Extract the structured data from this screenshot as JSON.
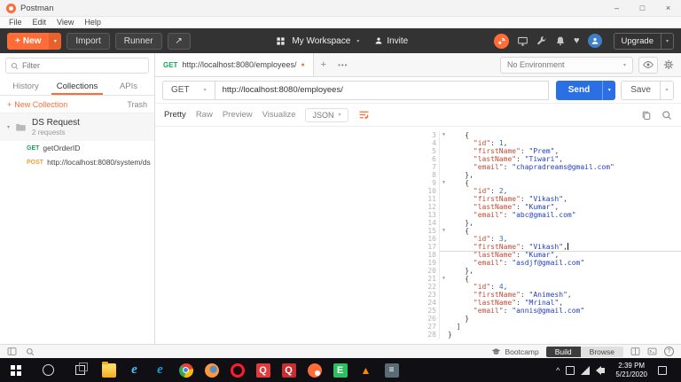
{
  "app": {
    "title": "Postman",
    "menu": [
      "File",
      "Edit",
      "View",
      "Help"
    ]
  },
  "icons": {
    "plus": "+",
    "caret": "▾",
    "dots": "•••",
    "close": "×",
    "minimize": "–",
    "maximize": "□",
    "heart": "♥",
    "open_new": "↗",
    "unsaved_dot": "●",
    "fold": "▼",
    "hidden_caret": "^",
    "question": "?"
  },
  "toolbar": {
    "new_label": "New",
    "import_label": "Import",
    "runner_label": "Runner",
    "workspace_label": "My Workspace",
    "invite_label": "Invite",
    "upgrade_label": "Upgrade"
  },
  "sidebar": {
    "filter_placeholder": "Filter",
    "tabs": [
      "History",
      "Collections",
      "APIs"
    ],
    "active_tab": "Collections",
    "new_collection_label": "New Collection",
    "trash_label": "Trash",
    "collection": {
      "name": "DS Request",
      "meta": "2 requests",
      "items": [
        {
          "method": "GET",
          "label": "getOrderID"
        },
        {
          "method": "POST",
          "label": "http://localhost:8080/system/ds"
        }
      ]
    }
  },
  "request_tab": {
    "method": "GET",
    "url": "http://localhost:8080/employees/"
  },
  "environment": {
    "selected": "No Environment"
  },
  "request_bar": {
    "method": "GET",
    "url": "http://localhost:8080/employees/",
    "send_label": "Send",
    "save_label": "Save"
  },
  "response": {
    "view_tabs": [
      "Pretty",
      "Raw",
      "Preview",
      "Visualize"
    ],
    "active_view": "Pretty",
    "language": "JSON",
    "lines": [
      {
        "n": 3,
        "lvl": 2,
        "f": true,
        "t": [
          [
            "p",
            "{"
          ]
        ]
      },
      {
        "n": 4,
        "lvl": 3,
        "t": [
          [
            "k",
            "\"id\""
          ],
          [
            "p",
            ": "
          ],
          [
            "m",
            "1"
          ],
          [
            "p",
            ","
          ]
        ]
      },
      {
        "n": 5,
        "lvl": 3,
        "t": [
          [
            "k",
            "\"firstName\""
          ],
          [
            "p",
            ": "
          ],
          [
            "s",
            "\"Prem\""
          ],
          [
            "p",
            ","
          ]
        ]
      },
      {
        "n": 6,
        "lvl": 3,
        "t": [
          [
            "k",
            "\"lastName\""
          ],
          [
            "p",
            ": "
          ],
          [
            "s",
            "\"Tiwari\""
          ],
          [
            "p",
            ","
          ]
        ]
      },
      {
        "n": 7,
        "lvl": 3,
        "t": [
          [
            "k",
            "\"email\""
          ],
          [
            "p",
            ": "
          ],
          [
            "s",
            "\"chapradreams@gmail.com\""
          ]
        ]
      },
      {
        "n": 8,
        "lvl": 2,
        "t": [
          [
            "p",
            "},"
          ]
        ]
      },
      {
        "n": 9,
        "lvl": 2,
        "f": true,
        "t": [
          [
            "p",
            "{"
          ]
        ]
      },
      {
        "n": 10,
        "lvl": 3,
        "t": [
          [
            "k",
            "\"id\""
          ],
          [
            "p",
            ": "
          ],
          [
            "m",
            "2"
          ],
          [
            "p",
            ","
          ]
        ]
      },
      {
        "n": 11,
        "lvl": 3,
        "t": [
          [
            "k",
            "\"firstName\""
          ],
          [
            "p",
            ": "
          ],
          [
            "s",
            "\"Vikash\""
          ],
          [
            "p",
            ","
          ]
        ]
      },
      {
        "n": 12,
        "lvl": 3,
        "t": [
          [
            "k",
            "\"lastName\""
          ],
          [
            "p",
            ": "
          ],
          [
            "s",
            "\"Kumar\""
          ],
          [
            "p",
            ","
          ]
        ]
      },
      {
        "n": 13,
        "lvl": 3,
        "t": [
          [
            "k",
            "\"email\""
          ],
          [
            "p",
            ": "
          ],
          [
            "s",
            "\"abc@gmail.com\""
          ]
        ]
      },
      {
        "n": 14,
        "lvl": 2,
        "t": [
          [
            "p",
            "},"
          ]
        ]
      },
      {
        "n": 15,
        "lvl": 2,
        "f": true,
        "t": [
          [
            "p",
            "{"
          ]
        ]
      },
      {
        "n": 16,
        "lvl": 3,
        "t": [
          [
            "k",
            "\"id\""
          ],
          [
            "p",
            ": "
          ],
          [
            "m",
            "3"
          ],
          [
            "p",
            ","
          ]
        ]
      },
      {
        "n": 17,
        "lvl": 3,
        "c": true,
        "t": [
          [
            "k",
            "\"firstName\""
          ],
          [
            "p",
            ": "
          ],
          [
            "s",
            "\"Vikash\""
          ],
          [
            "p",
            ","
          ]
        ]
      },
      {
        "n": 18,
        "lvl": 3,
        "t": [
          [
            "k",
            "\"lastName\""
          ],
          [
            "p",
            ": "
          ],
          [
            "s",
            "\"Kumar\""
          ],
          [
            "p",
            ","
          ]
        ]
      },
      {
        "n": 19,
        "lvl": 3,
        "t": [
          [
            "k",
            "\"email\""
          ],
          [
            "p",
            ": "
          ],
          [
            "s",
            "\"asdjf@gmail.com\""
          ]
        ]
      },
      {
        "n": 20,
        "lvl": 2,
        "t": [
          [
            "p",
            "},"
          ]
        ]
      },
      {
        "n": 21,
        "lvl": 2,
        "f": true,
        "t": [
          [
            "p",
            "{"
          ]
        ]
      },
      {
        "n": 22,
        "lvl": 3,
        "t": [
          [
            "k",
            "\"id\""
          ],
          [
            "p",
            ": "
          ],
          [
            "m",
            "4"
          ],
          [
            "p",
            ","
          ]
        ]
      },
      {
        "n": 23,
        "lvl": 3,
        "t": [
          [
            "k",
            "\"firstName\""
          ],
          [
            "p",
            ": "
          ],
          [
            "s",
            "\"Animesh\""
          ],
          [
            "p",
            ","
          ]
        ]
      },
      {
        "n": 24,
        "lvl": 3,
        "t": [
          [
            "k",
            "\"lastName\""
          ],
          [
            "p",
            ": "
          ],
          [
            "s",
            "\"Mrinal\""
          ],
          [
            "p",
            ","
          ]
        ]
      },
      {
        "n": 25,
        "lvl": 3,
        "t": [
          [
            "k",
            "\"email\""
          ],
          [
            "p",
            ": "
          ],
          [
            "s",
            "\"annis@gmail.com\""
          ]
        ]
      },
      {
        "n": 26,
        "lvl": 2,
        "t": [
          [
            "p",
            "}"
          ]
        ]
      },
      {
        "n": 27,
        "lvl": 1,
        "t": [
          [
            "p",
            "]"
          ]
        ]
      },
      {
        "n": 28,
        "lvl": 0,
        "t": [
          [
            "p",
            "}"
          ]
        ]
      }
    ]
  },
  "footer": {
    "bootcamp_label": "Bootcamp",
    "build_label": "Build",
    "browse_label": "Browse"
  },
  "taskbar": {
    "apps": [
      {
        "name": "file-explorer"
      },
      {
        "name": "internet-explorer",
        "glyph": "e"
      },
      {
        "name": "microsoft-edge",
        "glyph": "e"
      },
      {
        "name": "google-chrome"
      },
      {
        "name": "firefox"
      },
      {
        "name": "opera"
      },
      {
        "name": "qq",
        "glyph": "Q"
      },
      {
        "name": "qq-browser",
        "glyph": "Q"
      },
      {
        "name": "postman"
      },
      {
        "name": "evernote",
        "glyph": "E"
      },
      {
        "name": "vlc",
        "glyph": "▲"
      },
      {
        "name": "notepad",
        "glyph": "≡"
      }
    ],
    "clock": {
      "time": "2:39 PM",
      "date": "5/21/2020"
    }
  },
  "colors": {
    "brand": "#FF6C37",
    "send_button": "#2B6FE4",
    "get_method": "#18A558",
    "post_method": "#E9A13B",
    "json_key": "#BE4B33",
    "json_string": "#2340C2",
    "json_number": "#1D77C4"
  }
}
